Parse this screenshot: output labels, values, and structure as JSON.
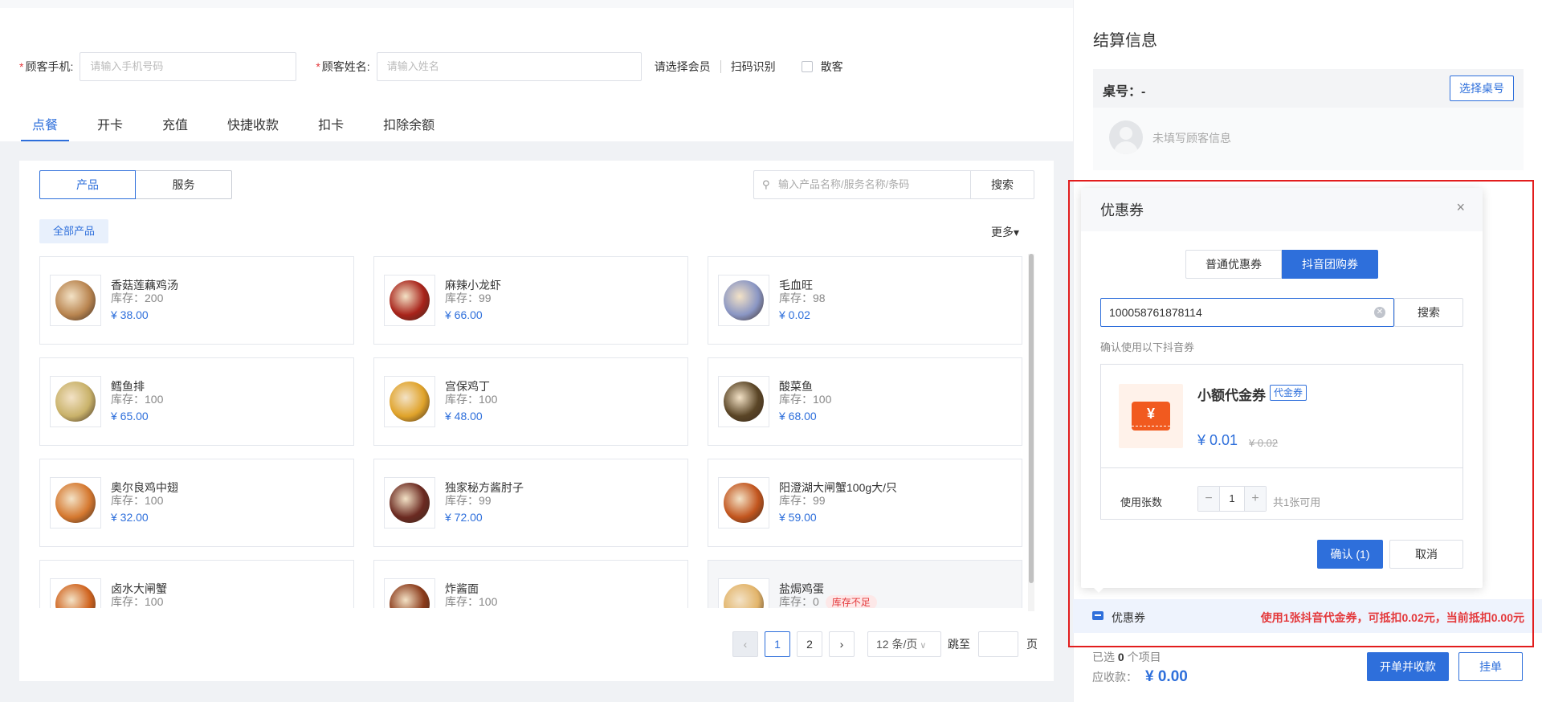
{
  "customer": {
    "phone_label": "顾客手机:",
    "phone_placeholder": "请输入手机号码",
    "name_label": "顾客姓名:",
    "name_placeholder": "请输入姓名",
    "required_mark": "*",
    "select_member": "请选择会员",
    "scan": "扫码识别",
    "walk_in": "散客"
  },
  "tabs": [
    "点餐",
    "开卡",
    "充值",
    "快捷收款",
    "扣卡",
    "扣除余额"
  ],
  "active_tab": "点餐",
  "segment": {
    "product": "产品",
    "service": "服务"
  },
  "search": {
    "placeholder": "输入产品名称/服务名称/条码",
    "button": "搜索"
  },
  "category": "全部产品",
  "more": "更多▾",
  "products": [
    {
      "name": "香菇莲藕鸡汤",
      "stock": "库存：200",
      "price": "¥ 38.00",
      "dish_color": "#b98550"
    },
    {
      "name": "麻辣小龙虾",
      "stock": "库存：99",
      "price": "¥ 66.00",
      "dish_color": "#a8231a"
    },
    {
      "name": "毛血旺",
      "stock": "库存：98",
      "price": "¥ 0.02",
      "dish_color": "#8a96c4"
    },
    {
      "name": "鳕鱼排",
      "stock": "库存：100",
      "price": "¥ 65.00",
      "dish_color": "#c9b26a"
    },
    {
      "name": "宫保鸡丁",
      "stock": "库存：100",
      "price": "¥ 48.00",
      "dish_color": "#e0a32a"
    },
    {
      "name": "酸菜鱼",
      "stock": "库存：100",
      "price": "¥ 68.00",
      "dish_color": "#5a4526"
    },
    {
      "name": "奥尔良鸡中翅",
      "stock": "库存：100",
      "price": "¥ 32.00",
      "dish_color": "#d5782f"
    },
    {
      "name": "独家秘方酱肘子",
      "stock": "库存：99",
      "price": "¥ 72.00",
      "dish_color": "#6b2a21"
    },
    {
      "name": "阳澄湖大闸蟹100g大/只",
      "stock": "库存：99",
      "price": "¥ 59.00",
      "dish_color": "#c2551e"
    },
    {
      "name": "卤水大闸蟹",
      "stock": "库存：100",
      "price": "",
      "dish_color": "#d0641f"
    },
    {
      "name": "炸酱面",
      "stock": "库存：100",
      "price": "",
      "dish_color": "#8a3a1a"
    },
    {
      "name": "盐焗鸡蛋",
      "stock": "库存：0",
      "price": "",
      "dish_color": "#e2b46a",
      "low_stock": "库存不足"
    }
  ],
  "pager": {
    "prev": "‹",
    "pages": [
      "1",
      "2"
    ],
    "current": "1",
    "next": "›",
    "size": "12 条/页",
    "jump": "跳至",
    "page_unit": "页"
  },
  "settlement": {
    "title": "结算信息",
    "table_label": "桌号：-",
    "select_table": "选择桌号",
    "no_customer": "未填写顾客信息"
  },
  "coupon_popup": {
    "title": "优惠券",
    "close": "×",
    "tab_normal": "普通优惠券",
    "tab_douyin": "抖音团购券",
    "code": "100058761878114",
    "search": "搜索",
    "confirm_hint": "确认使用以下抖音券",
    "coupon_name": "小额代金券",
    "coupon_badge": "代金券",
    "coupon_icon_glyph": "¥",
    "coupon_price": "¥ 0.01",
    "coupon_orig": "¥ 0.02",
    "qty_label": "使用张数",
    "qty_minus": "−",
    "qty_value": "1",
    "qty_plus": "+",
    "available": "共1张可用",
    "ok": "确认 (1)",
    "cancel": "取消"
  },
  "coupon_bar": {
    "label": "优惠券",
    "message": "使用1张抖音代金券，可抵扣0.02元，当前抵扣0.00元"
  },
  "summary": {
    "selected_prefix": "已选",
    "selected_count": "0",
    "selected_suffix": "个项目",
    "due_label": "应收款：",
    "due_amount": "¥ 0.00",
    "pay_button": "开单并收款",
    "hang_button": "挂单"
  },
  "colors": {
    "primary": "#2e6fdb",
    "danger": "#e4393c",
    "highlight_frame": "#e21d1d"
  }
}
